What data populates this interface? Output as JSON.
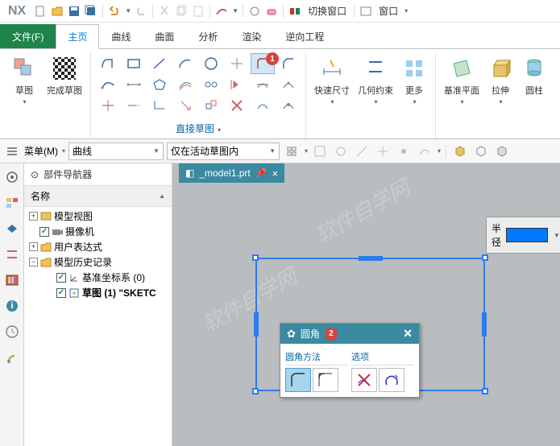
{
  "app": {
    "logo": "NX"
  },
  "titlebar": {
    "switch_window": "切换窗口",
    "window": "窗口"
  },
  "menu": {
    "file": "文件(F)",
    "home": "主页",
    "curve": "曲线",
    "surface": "曲面",
    "analysis": "分析",
    "render": "渲染",
    "reverse": "逆向工程"
  },
  "ribbon": {
    "sketch": "草图",
    "finish_sketch": "完成草图",
    "direct_sketch": "直接草图",
    "quick_dim": "快速尺寸",
    "geo_constraint": "几何约束",
    "more": "更多",
    "datum_plane": "基准平面",
    "extrude": "拉伸",
    "cylinder": "圆柱"
  },
  "optbar": {
    "menu": "菜单(M)",
    "curve_filter": "曲线",
    "scope": "仅在活动草图内"
  },
  "nav": {
    "title": "部件导航器",
    "col_name": "名称",
    "model_view": "模型视图",
    "camera": "摄像机",
    "user_expr": "用户表达式",
    "model_history": "模型历史记录",
    "datum_csys": "基准坐标系 (0)",
    "sketch": "草图 (1) \"SKETC"
  },
  "tab": {
    "name": "_model1.prt"
  },
  "radius": {
    "label": "半径"
  },
  "dialog": {
    "title": "圆角",
    "method": "圆角方法",
    "options": "选项"
  },
  "badges": {
    "b1": "1",
    "b2": "2"
  }
}
